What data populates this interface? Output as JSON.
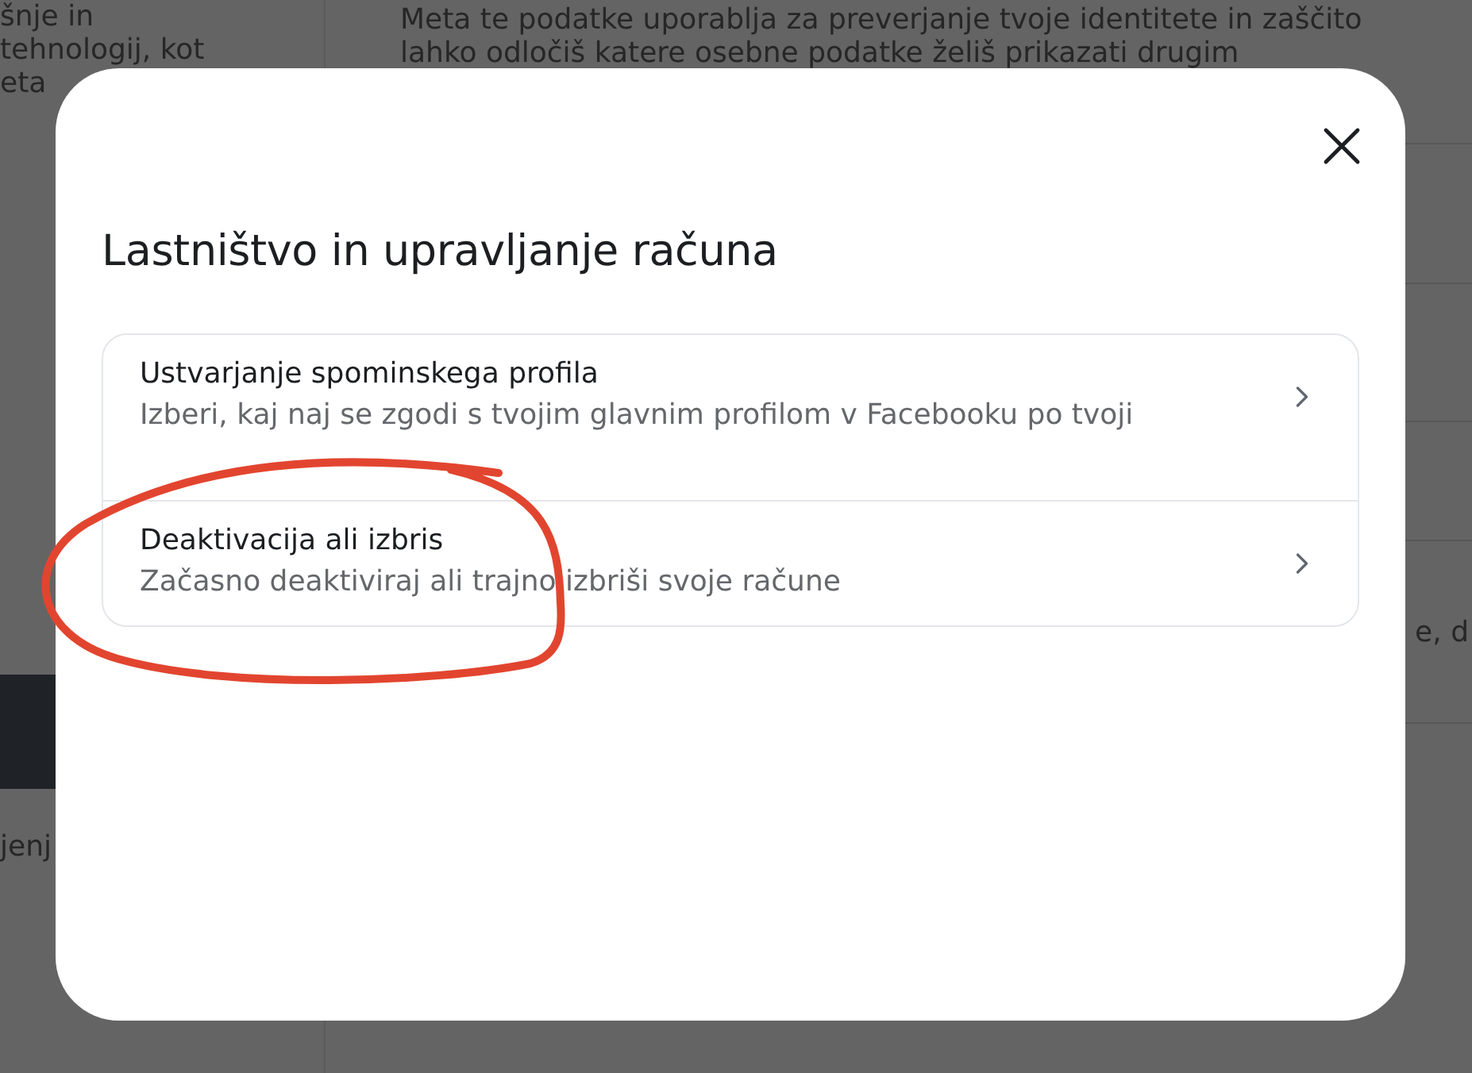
{
  "background": {
    "left_lines": [
      "šnje in",
      "tehnologij, kot",
      "eta"
    ],
    "left_lower": "jenj",
    "right_lines": [
      "Meta te podatke uporablja za preverjanje tvoje identitete in zaščito",
      "lahko odločiš katere osebne podatke želiš prikazati drugim"
    ],
    "right_lower": "e, d"
  },
  "dialog": {
    "title": "Lastništvo in upravljanje računa",
    "items": [
      {
        "title": "Ustvarjanje spominskega profila",
        "description": "Izberi, kaj naj se zgodi s tvojim glavnim profilom v Facebooku po tvoji"
      },
      {
        "title": "Deaktivacija ali izbris",
        "description": "Začasno deaktiviraj ali trajno izbriši svoje račune"
      }
    ]
  }
}
